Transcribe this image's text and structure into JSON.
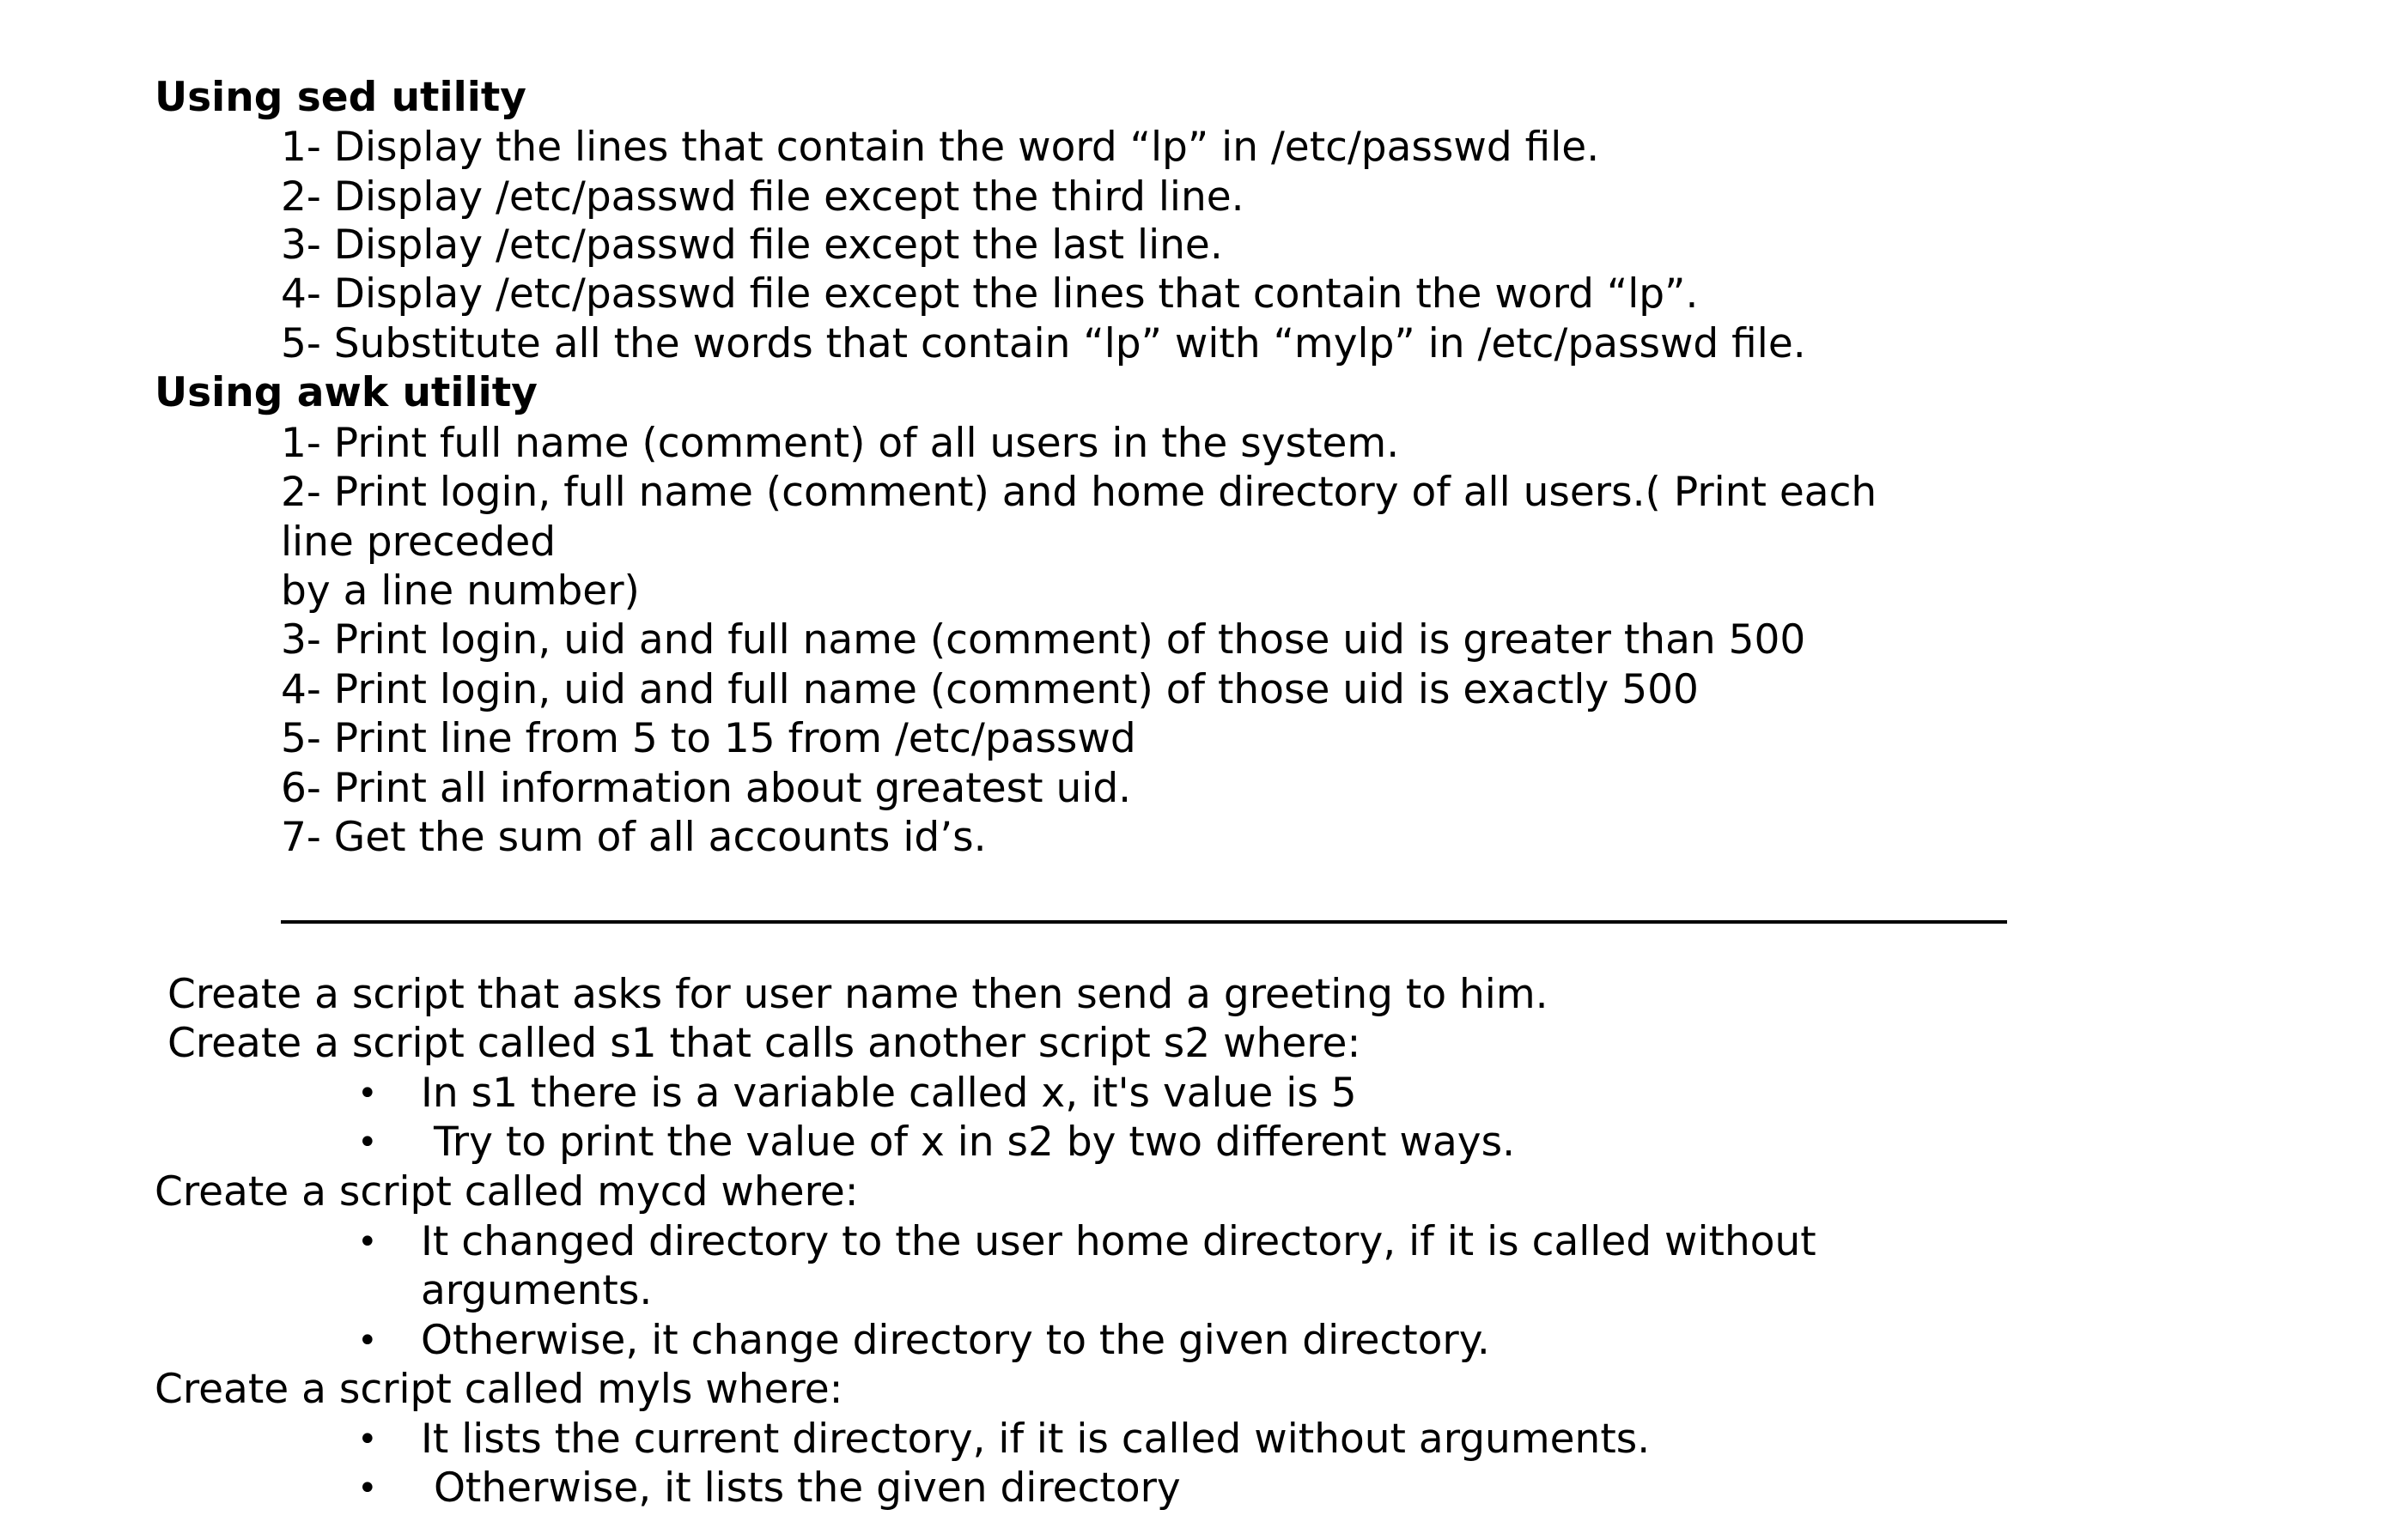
{
  "sed_section": {
    "heading": "Using sed utility",
    "items": [
      "1- Display the lines that contain the word “lp” in /etc/passwd file.",
      "2- Display /etc/passwd file except the third line.",
      "3- Display /etc/passwd file except the last line.",
      "4- Display /etc/passwd file except the lines that contain the word “lp”.",
      "5- Substitute all the words that contain “lp” with “mylp” in /etc/passwd file."
    ]
  },
  "awk_section": {
    "heading": "Using awk utility",
    "items": [
      "1- Print full name (comment) of all users in the system.",
      "2- Print login, full name (comment) and home directory of all users.( Print each",
      "line preceded",
      "by a line number)",
      "3- Print login, uid and full name (comment) of those uid is greater than 500",
      "4- Print login, uid and full name (comment) of those uid is exactly 500",
      "5- Print line from 5 to 15 from /etc/passwd",
      "6- Print all information about greatest uid.",
      "7- Get the sum of all accounts id’s."
    ]
  },
  "scripts": {
    "greeting": "Create a script that asks for user name then send a greeting to him.",
    "s1_intro": "Create a script called s1 that calls another script s2 where:",
    "s1_bullets": [
      "In s1 there is a variable called x, it's value is 5",
      " Try to print the value of x in s2 by two different ways."
    ],
    "mycd_intro": "Create a script called mycd where:",
    "mycd_bullets": [
      "It changed directory to the user home directory, if it is called without",
      "arguments.",
      "Otherwise, it change directory to the given directory."
    ],
    "myls_intro": "Create a script called myls where:",
    "myls_bullets": [
      "It lists the current directory, if it is called without arguments.",
      " Otherwise, it lists the given directory"
    ],
    "bullet_char": "•"
  }
}
